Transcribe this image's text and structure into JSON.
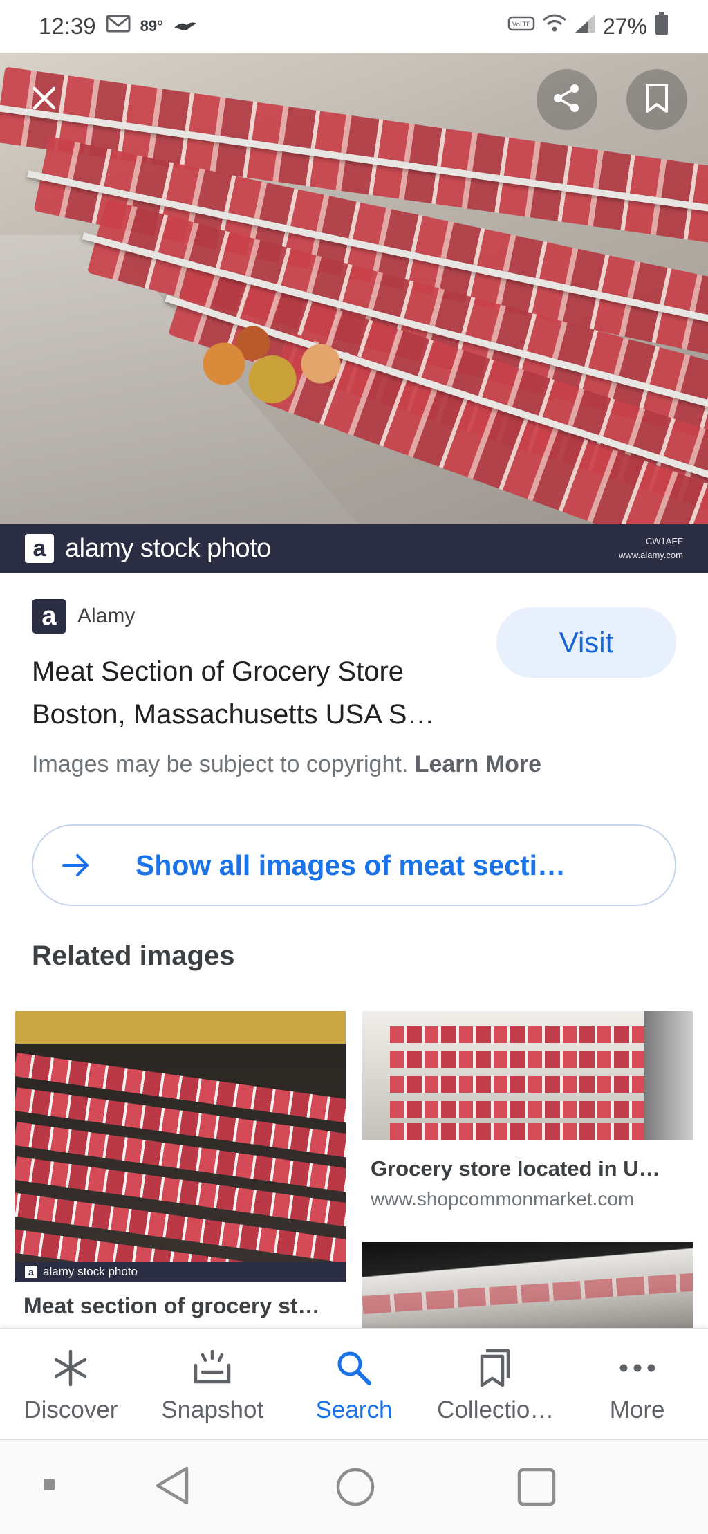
{
  "status_bar": {
    "time": "12:39",
    "temperature": "89°",
    "battery": "27%",
    "icons": [
      "gmail-icon",
      "bird-icon",
      "volte-icon",
      "wifi-icon",
      "signal-icon",
      "battery-icon"
    ]
  },
  "hero": {
    "watermark_brand": "alamy stock photo",
    "watermark_logo": "a",
    "watermark_code": "CW1AEF",
    "watermark_url": "www.alamy.com",
    "icons": [
      "close-icon",
      "share-icon",
      "bookmark-icon"
    ]
  },
  "source": {
    "logo_letter": "a",
    "name": "Alamy",
    "title": "Meat Section of Grocery Store Boston, Massachusetts USA S…",
    "visit_label": "Visit",
    "copyright_text": "Images may be subject to copyright.",
    "learn_more": "Learn More"
  },
  "show_all": {
    "label": "Show all images of meat secti…"
  },
  "related": {
    "heading": "Related images",
    "items": [
      {
        "caption": "Meat section of grocery st…",
        "watermark": "alamy stock photo"
      },
      {
        "caption": "Grocery store located in U…",
        "url": "www.shopcommonmarket.com"
      }
    ]
  },
  "bottom_nav": {
    "items": [
      {
        "label": "Discover",
        "icon": "asterisk-icon"
      },
      {
        "label": "Snapshot",
        "icon": "snapshot-icon"
      },
      {
        "label": "Search",
        "icon": "search-icon",
        "active": true
      },
      {
        "label": "Collectio…",
        "icon": "collections-icon"
      },
      {
        "label": "More",
        "icon": "more-dots-icon"
      }
    ]
  },
  "colors": {
    "accent": "#1a73e8",
    "visit_bg": "#e8f0fe",
    "watermark_bar": "#2b2d42"
  }
}
